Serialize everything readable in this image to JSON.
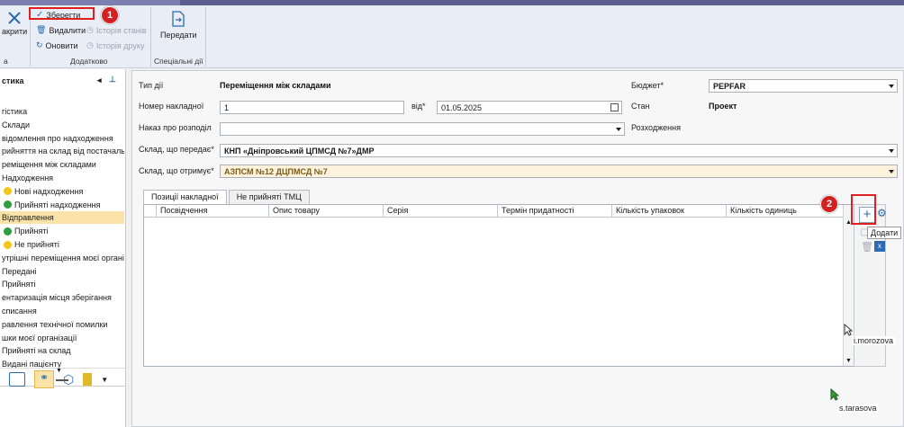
{
  "ribbon": {
    "close_label": "акрити",
    "save_label": "Зберегти",
    "delete_label": "Видалити",
    "refresh_label": "Оновити",
    "state_history_label": "Історія станів",
    "print_history_label": "Історія друку",
    "transfer_label": "Передати",
    "group_a_label": "а",
    "group_additional_label": "Додатково",
    "group_special_label": "Спеціальні дії"
  },
  "sidebar": {
    "title": "стика",
    "items": [
      {
        "label": "гістика",
        "dot": ""
      },
      {
        "label": "Склади",
        "dot": ""
      },
      {
        "label": "відомлення про надходження",
        "dot": ""
      },
      {
        "label": "рийняття на склад від постачальн",
        "dot": ""
      },
      {
        "label": "реміщення між складами",
        "dot": ""
      },
      {
        "label": "Надходження",
        "dot": ""
      },
      {
        "label": "Нові надходження",
        "dot": "#f5c518"
      },
      {
        "label": "Прийняті надходження",
        "dot": "#2e9e3e"
      },
      {
        "label": "Відправлення",
        "dot": ""
      },
      {
        "label": "Прийняті",
        "dot": "#2e9e3e"
      },
      {
        "label": "Не прийняті",
        "dot": "#f5c518"
      },
      {
        "label": "утрішні переміщення моєї організ",
        "dot": ""
      },
      {
        "label": "Передані",
        "dot": ""
      },
      {
        "label": "Прийняті",
        "dot": ""
      },
      {
        "label": "ентаризація місця зберігання",
        "dot": ""
      },
      {
        "label": "списання",
        "dot": ""
      },
      {
        "label": "равлення технічної помилки",
        "dot": ""
      },
      {
        "label": "шки моєї організації",
        "dot": ""
      },
      {
        "label": "Прийняті на склад",
        "dot": ""
      },
      {
        "label": "Видані пацієнту",
        "dot": ""
      }
    ]
  },
  "form": {
    "type_label": "Тип дії",
    "type_value": "Переміщення між складами",
    "budget_label": "Бюджет*",
    "budget_value": "PEPFAR",
    "number_label": "Номер накладної",
    "number_value": "1",
    "from_label": "від*",
    "date_value": "01.05.2025",
    "state_label": "Стан",
    "state_value": "Проект",
    "order_label": "Наказ про розподіл",
    "order_value": "",
    "discrepancy_label": "Розходження",
    "sender_label": "Склад, що передає*",
    "sender_value": "КНП «Дніпровський ЦПМСД №7»ДМР",
    "receiver_label": "Склад, що отримує*",
    "receiver_value": "АЗПСМ №12 ДЦПМСД №7"
  },
  "tabs": [
    "Позиції накладної",
    "Не прийняті ТМЦ"
  ],
  "grid": {
    "columns": [
      "Посвідчення",
      "Опис товару",
      "Серія",
      "Термін придатності",
      "Кількість упаковок",
      "Кількість одиниць"
    ]
  },
  "annotations": {
    "marker1": "1",
    "marker2": "2",
    "tooltip": "Додати",
    "user1": "i.morozova",
    "user2": "s.tarasova"
  },
  "colors": {
    "accent": "#2b6cb0",
    "selected": "#fbe3a8",
    "marker": "#d42020"
  }
}
